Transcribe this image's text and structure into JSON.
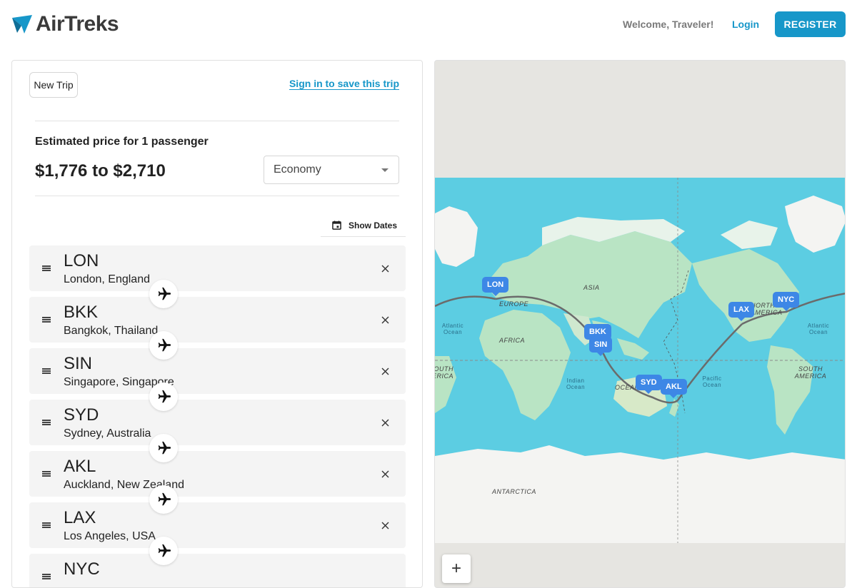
{
  "header": {
    "brand": "AirTreks",
    "welcome": "Welcome, Traveler!",
    "login_label": "Login",
    "register_label": "REGISTER"
  },
  "trip": {
    "new_trip_label": "New Trip",
    "signin_label": "Sign in to save this trip",
    "price_label": "Estimated price for 1 passenger",
    "price_value": "$1,776 to $2,710",
    "cabin_class": "Economy",
    "show_dates_label": "Show Dates",
    "stops": [
      {
        "code": "LON",
        "city": "London, England"
      },
      {
        "code": "BKK",
        "city": "Bangkok, Thailand"
      },
      {
        "code": "SIN",
        "city": "Singapore, Singapore"
      },
      {
        "code": "SYD",
        "city": "Sydney, Australia"
      },
      {
        "code": "AKL",
        "city": "Auckland, New Zealand"
      },
      {
        "code": "LAX",
        "city": "Los Angeles, USA"
      },
      {
        "code": "NYC",
        "city": ""
      }
    ]
  },
  "map": {
    "labels": {
      "asia": "ASIA",
      "europe": "EUROPE",
      "africa": "AFRICA",
      "north_america": "NORTH AMERICA",
      "south_america": "SOUTH AMERICA",
      "south_america_left": "SOUTH AMERICA",
      "oceania": "OCEANIA",
      "antarctica": "ANTARCTICA",
      "atlantic_left": "Atlantic Ocean",
      "atlantic_right": "Atlantic Ocean",
      "indian": "Indian Ocean",
      "pacific": "Pacific Ocean"
    },
    "pins": [
      "LON",
      "BKK",
      "SIN",
      "SYD",
      "AKL",
      "LAX",
      "NYC"
    ],
    "zoom_in_label": "+"
  },
  "colors": {
    "accent": "#1797c9",
    "pin": "#3d87e6",
    "ocean": "#5ccde2",
    "land": "#b9e4c4",
    "ice": "#f4f4f2",
    "route": "#6b6b6b"
  }
}
